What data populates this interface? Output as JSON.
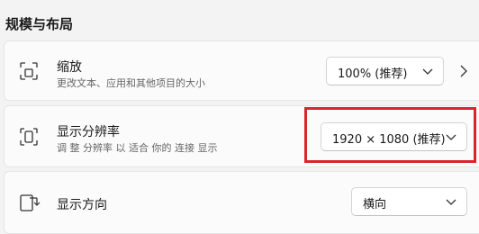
{
  "section": {
    "title": "规模与布局"
  },
  "scale": {
    "title": "缩放",
    "description": "更改文本、应用和其他项目的大小",
    "value": "100% (推荐)",
    "icon": "scale-icon"
  },
  "resolution": {
    "title": "显示分辨率",
    "description": "调 整 分辨率 以 适合 你的 连接 显示",
    "value": "1920 × 1080 (推荐)",
    "icon": "resolution-icon"
  },
  "orientation": {
    "title": "显示方向",
    "value": "横向",
    "icon": "orientation-icon"
  },
  "colors": {
    "highlight": "#d9262a",
    "card_bg": "#fbfbfb",
    "page_bg": "#f3f3f3"
  }
}
